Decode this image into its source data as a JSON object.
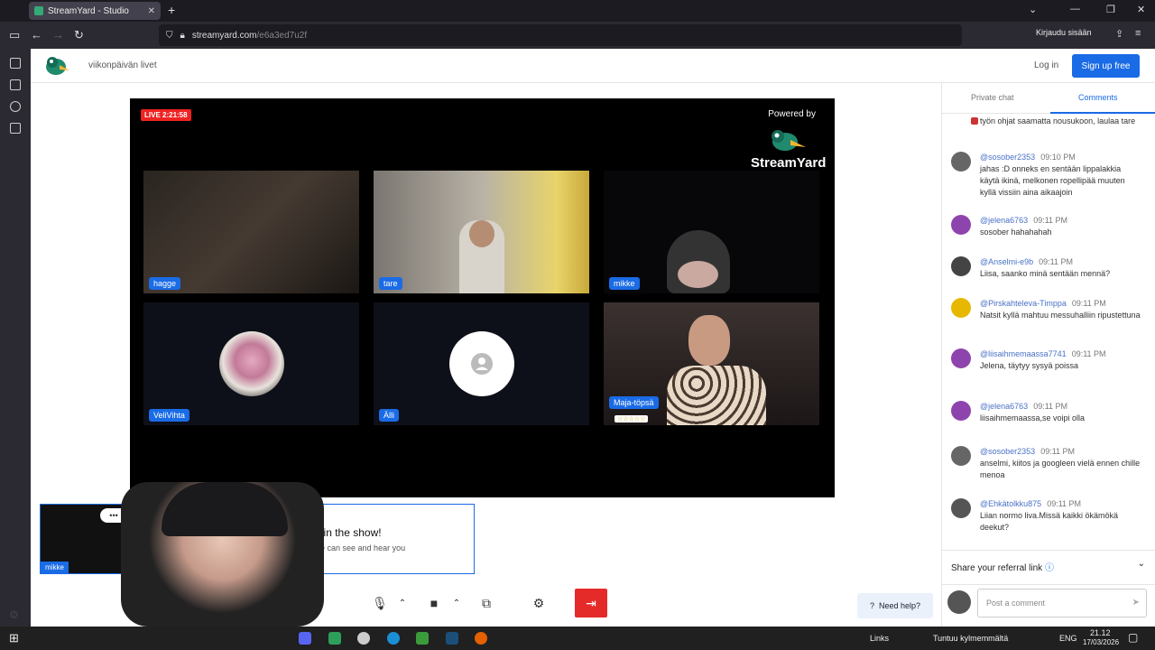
{
  "browser": {
    "tab_title": "StreamYard - Studio",
    "url_host": "streamyard.com",
    "url_path": "/e6a3ed7u2f",
    "signin": "Kirjaudu sisään"
  },
  "header": {
    "site_name": "viikonpäivän livet",
    "login": "Log in",
    "signup": "Sign up free"
  },
  "stage": {
    "live_label": "LIVE 2:21:58",
    "powered_by": "Powered by",
    "brand": "StreamYard"
  },
  "participants": [
    {
      "name": "hagge"
    },
    {
      "name": "tare"
    },
    {
      "name": "mikke"
    },
    {
      "name": "VeliVihta"
    },
    {
      "name": "Älli"
    },
    {
      "name": "Maja-töpsä",
      "stars": "☆☆☆☆☆"
    }
  ],
  "show": {
    "title": "You're in the show!",
    "subtitle": "Everyone can see and hear you",
    "self_label": "mikke"
  },
  "help": "Need help?",
  "chat": {
    "tabs": [
      "Private chat",
      "Comments"
    ],
    "messages": [
      {
        "author": "",
        "time": "",
        "text": "työn ohjat saamatta nousukoon, laulaa tare",
        "color": "#cc3333"
      },
      {
        "author": "@sosober2353",
        "time": "09:10 PM",
        "text": "jahas :D onneks en sentään lippalakkia käytä ikinä, melkonen ropellipää muuten kyllä vissiin aina aikaajoin",
        "color": "#666666"
      },
      {
        "author": "@jelena6763",
        "time": "09:11 PM",
        "text": "sosober hahahahah",
        "color": "#8e44ad"
      },
      {
        "author": "@Anselmi-e9b",
        "time": "09:11 PM",
        "text": "Liisa, saanko minä sentään mennä?",
        "color": "#444444"
      },
      {
        "author": "@Pirskahteleva-Timppa",
        "time": "09:11 PM",
        "text": "Natsit kyllä mahtuu messuhalliin ripustettuna",
        "color": "#e6b800"
      },
      {
        "author": "@liisaihmemaassa7741",
        "time": "09:11 PM",
        "text": "Jelena, täytyy sysyä poissa",
        "color": "#8e44ad"
      },
      {
        "author": "@jelena6763",
        "time": "09:11 PM",
        "text": "liisaihmemaassa,se voipi olla",
        "color": "#8e44ad"
      },
      {
        "author": "@sosober2353",
        "time": "09:11 PM",
        "text": "anselmi, kiitos ja googleen vielä ennen chille menoa",
        "color": "#666666"
      },
      {
        "author": "@Ehkätolkku875",
        "time": "09:11 PM",
        "text": "Liian normo liva.Missä kaikki ökämökä deekut?",
        "color": "#555555"
      }
    ],
    "referral": "Share your referral link",
    "comment_placeholder": "Post a comment"
  },
  "taskbar": {
    "links": "Links",
    "weather": "Tuntuu kylmemmältä",
    "lang": "ENG",
    "time": "21.12",
    "date": "17/03/2026"
  }
}
